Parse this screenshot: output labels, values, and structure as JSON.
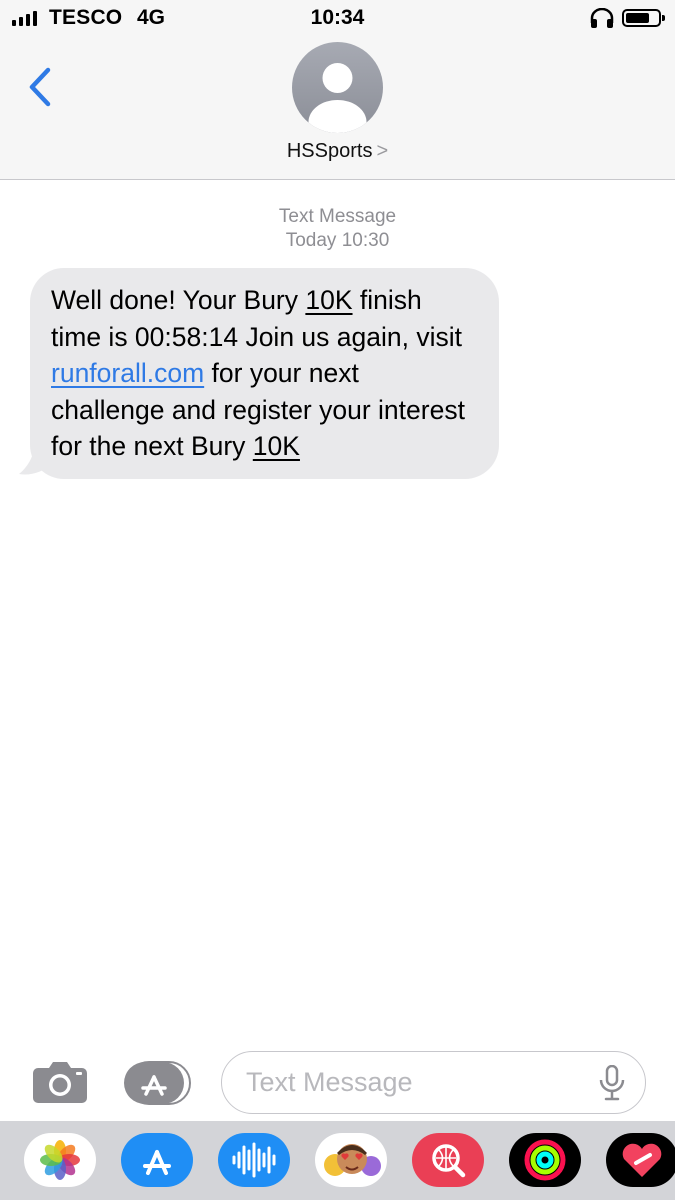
{
  "status_bar": {
    "carrier": "TESCO",
    "network": "4G",
    "time": "10:34",
    "icons": [
      "signal-bars-icon",
      "headphones-icon",
      "battery-icon"
    ]
  },
  "header": {
    "back_icon": "chevron-left-icon",
    "avatar_icon": "person-silhouette-icon",
    "contact_name": "HSSports",
    "contact_chevron": ">"
  },
  "conversation": {
    "service_label": "Text Message",
    "timestamp": "Today 10:30",
    "message": {
      "segments": [
        "Well done! Your Bury ",
        "10K",
        " finish time is 00:58:14 Join us again, visit ",
        "runforall.com",
        " for your next challenge and register your interest for the next Bury ",
        "10K"
      ]
    }
  },
  "compose": {
    "camera_icon": "camera-icon",
    "apps_icon": "app-store-icon",
    "placeholder": "Text Message",
    "value": "",
    "mic_icon": "microphone-icon"
  },
  "app_drawer": {
    "apps": [
      "photos-icon",
      "app-store-icon",
      "audio-message-icon",
      "memoji-stickers-icon",
      "web-search-icon",
      "activity-icon",
      "digital-touch-icon"
    ]
  },
  "colors": {
    "accent": "#2f7ae5",
    "bubble": "#e9e9eb",
    "header_bg": "#f6f6f6",
    "drawer_bg": "#d3d4d8"
  }
}
